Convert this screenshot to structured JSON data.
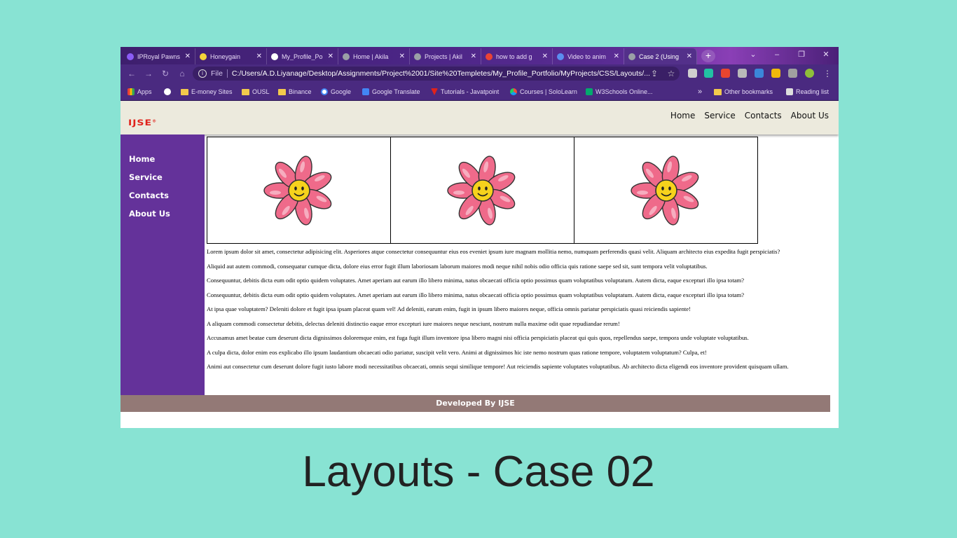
{
  "browser": {
    "tabs": [
      {
        "title": "IPRoyal Pawns",
        "favicon_color": "#8b5cf6"
      },
      {
        "title": "Honeygain",
        "favicon_color": "#f5d33a"
      },
      {
        "title": "My_Profile_Po",
        "favicon_color": "#ffffff"
      },
      {
        "title": "Home | Akila",
        "favicon_color": "#9aa0a6"
      },
      {
        "title": "Projects | Akil",
        "favicon_color": "#9aa0a6"
      },
      {
        "title": "how to add g",
        "favicon_color": "#ea4335"
      },
      {
        "title": "Video to anim",
        "favicon_color": "#5b8def"
      },
      {
        "title": "Case 2 (Using",
        "favicon_color": "#9aa0a6",
        "active": true
      }
    ],
    "new_tab_label": "+",
    "window_controls": {
      "dropdown": "⌄",
      "minimize": "–",
      "restore": "❐",
      "close": "✕"
    },
    "address": {
      "scheme_label": "File",
      "url": "C:/Users/A.D.Liyanage/Desktop/Assignments/Project%2001/Site%20Templetes/My_Profile_Portfolio/MyProjects/CSS/Layouts/..."
    },
    "bookmarks": [
      {
        "label": "Apps",
        "type": "apps"
      },
      {
        "label": "",
        "type": "icon"
      },
      {
        "label": "E-money Sites",
        "type": "folder"
      },
      {
        "label": "OUSL",
        "type": "folder"
      },
      {
        "label": "Binance",
        "type": "folder"
      },
      {
        "label": "Google",
        "type": "icon"
      },
      {
        "label": "Google Translate",
        "type": "icon"
      },
      {
        "label": "Tutorials - Javatpoint",
        "type": "icon"
      },
      {
        "label": "Courses | SoloLearn",
        "type": "icon"
      },
      {
        "label": "W3Schools Online...",
        "type": "icon"
      }
    ],
    "bookmarks_overflow": "»",
    "other_bookmarks": "Other bookmarks",
    "reading_list": "Reading list"
  },
  "site": {
    "logo": "IJSE",
    "logo_mark": "®",
    "nav": [
      "Home",
      "Service",
      "Contacts",
      "About Us"
    ],
    "sidebar": [
      "Home",
      "Service",
      "Contacts",
      "About Us"
    ],
    "gallery": {
      "count": 3,
      "petal_color": "#ef6a8a",
      "center_color": "#f6d21c"
    },
    "paragraphs": [
      "Lorem ipsum dolor sit amet, consectetur adipisicing elit. Asperiores atque consectetur consequuntur eius eos eveniet ipsum iure magnam mollitia nemo, numquam perferendis quasi velit. Aliquam architecto eius expedita fugit perspiciatis?",
      "Aliquid aut autem commodi, consequatur cumque dicta, dolore eius error fugit illum laboriosam laborum maiores modi neque nihil nobis odio officia quis ratione saepe sed sit, sunt tempora velit voluptatibus.",
      "Consequuntur, debitis dicta eum odit optio quidem voluptates. Amet aperiam aut earum illo libero minima, natus obcaecati officia optio possimus quam voluptatibus voluptatum. Autem dicta, eaque excepturi illo ipsa totam?",
      "Consequuntur, debitis dicta eum odit optio quidem voluptates. Amet aperiam aut earum illo libero minima, natus obcaecati officia optio possimus quam voluptatibus voluptatum. Autem dicta, eaque excepturi illo ipsa totam?",
      "At ipsa quae voluptatem? Deleniti dolore et fugit ipsa ipsam placeat quam vel! Ad deleniti, earum enim, fugit in ipsum libero maiores neque, officia omnis pariatur perspiciatis quasi reiciendis sapiente!",
      "A aliquam commodi consectetur debitis, delectus deleniti distinctio eaque error excepturi iure maiores neque nesciunt, nostrum nulla maxime odit quae repudiandae rerum!",
      "Accusamus amet beatae cum deserunt dicta dignissimos doloremque enim, est fuga fugit illum inventore ipsa libero magni nisi officia perspiciatis placeat qui quis quos, repellendus saepe, tempora unde voluptate voluptatibus.",
      "A culpa dicta, dolor enim eos explicabo illo ipsum laudantium obcaecati odio pariatur, suscipit velit vero. Animi at dignissimos hic iste nemo nostrum quas ratione tempore, voluptatem voluptatum? Culpa, et!",
      "Animi aut consectetur cum deserunt dolore fugit iusto labore modi necessitatibus obcaecati, omnis sequi similique tempore! Aut reiciendis sapiente voluptates voluptatibus. Ab architecto dicta eligendi eos inventore provident quisquam ullam."
    ],
    "footer": "Developed By IJSE",
    "colors": {
      "sidebar": "#64329a",
      "header": "#eceadd",
      "footer": "#937976",
      "logo": "#e0221b"
    }
  },
  "slide_caption": "Layouts - Case 02",
  "slide_background": "#88e3d3"
}
